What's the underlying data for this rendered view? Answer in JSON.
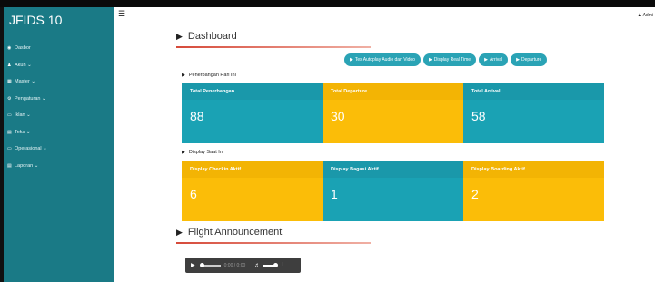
{
  "brand": "JFIDS 10",
  "user": "Admi",
  "sidebar": {
    "items": [
      {
        "icon": "dashboard-icon",
        "glyph": "◉",
        "label": "Dasbor"
      },
      {
        "icon": "user-icon",
        "glyph": "♟",
        "label": "Akun ⌄"
      },
      {
        "icon": "database-icon",
        "glyph": "▦",
        "label": "Master ⌄"
      },
      {
        "icon": "gear-icon",
        "glyph": "⚙",
        "label": "Pengaturan ⌄"
      },
      {
        "icon": "monitor-icon",
        "glyph": "▭",
        "label": "Iklan ⌄"
      },
      {
        "icon": "file-icon",
        "glyph": "▤",
        "label": "Teks ⌄"
      },
      {
        "icon": "desktop-icon",
        "glyph": "▭",
        "label": "Operasional ⌄"
      },
      {
        "icon": "report-icon",
        "glyph": "▤",
        "label": "Laporan ⌄"
      }
    ]
  },
  "dashboard": {
    "title": "Dashboard",
    "buttons": [
      {
        "label": "Tes Autoplay Audio dan Video"
      },
      {
        "label": "Display Real Time"
      },
      {
        "label": "Arrival"
      },
      {
        "label": "Departure"
      }
    ]
  },
  "flights_today": {
    "title": "Penerbangan Hari Ini",
    "cards": [
      {
        "label": "Total Penerbangan",
        "value": "88",
        "color": "#1aa2b4"
      },
      {
        "label": "Total Departure",
        "value": "30",
        "color": "#fbbd08"
      },
      {
        "label": "Total Arrival",
        "value": "58",
        "color": "#1aa2b4"
      }
    ]
  },
  "display_now": {
    "title": "Display Saat Ini",
    "cards": [
      {
        "label": "Display Checkin Aktif",
        "value": "6",
        "color": "#fbbd08"
      },
      {
        "label": "Display Bagasi Aktif",
        "value": "1",
        "color": "#1aa2b4"
      },
      {
        "label": "Display Boarding Aktif",
        "value": "2",
        "color": "#fbbd08"
      }
    ]
  },
  "announcement": {
    "title": "Flight Announcement",
    "audio": {
      "time": "0:00 / 0:00"
    }
  },
  "colors": {
    "sidebar": "#1a7a86",
    "teal": "#1aa2b4",
    "gold": "#fbbd08",
    "button": "#2aa3b5",
    "accent_line": "#d64a3a"
  }
}
